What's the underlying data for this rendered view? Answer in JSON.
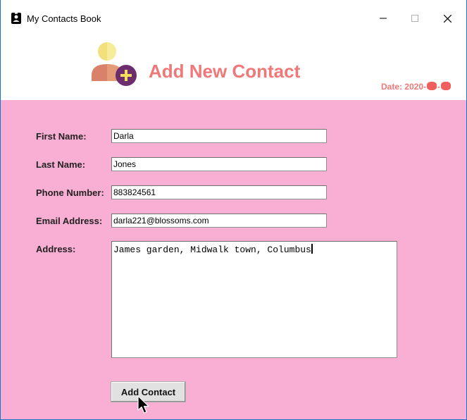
{
  "window": {
    "title": "My Contacts Book",
    "controls": [
      "minimize-icon",
      "maximize-icon",
      "close-icon"
    ]
  },
  "header": {
    "title": "Add New Contact",
    "date_prefix": "Date: 2020-",
    "logo_icon": "add-user-icon"
  },
  "form": {
    "first_name": {
      "label": "First Name:",
      "value": "Darla"
    },
    "last_name": {
      "label": "Last Name:",
      "value": "Jones"
    },
    "phone": {
      "label": "Phone Number:",
      "value": "883824561"
    },
    "email": {
      "label": "Email Address:",
      "value": "darla221@blossoms.com"
    },
    "address": {
      "label": "Address:",
      "value": "James garden, Midwalk town, Columbus"
    },
    "submit_label": "Add Contact"
  },
  "colors": {
    "accent": "#ef7878",
    "form_background": "#f9aed4",
    "window_border": "#1a73c9"
  }
}
